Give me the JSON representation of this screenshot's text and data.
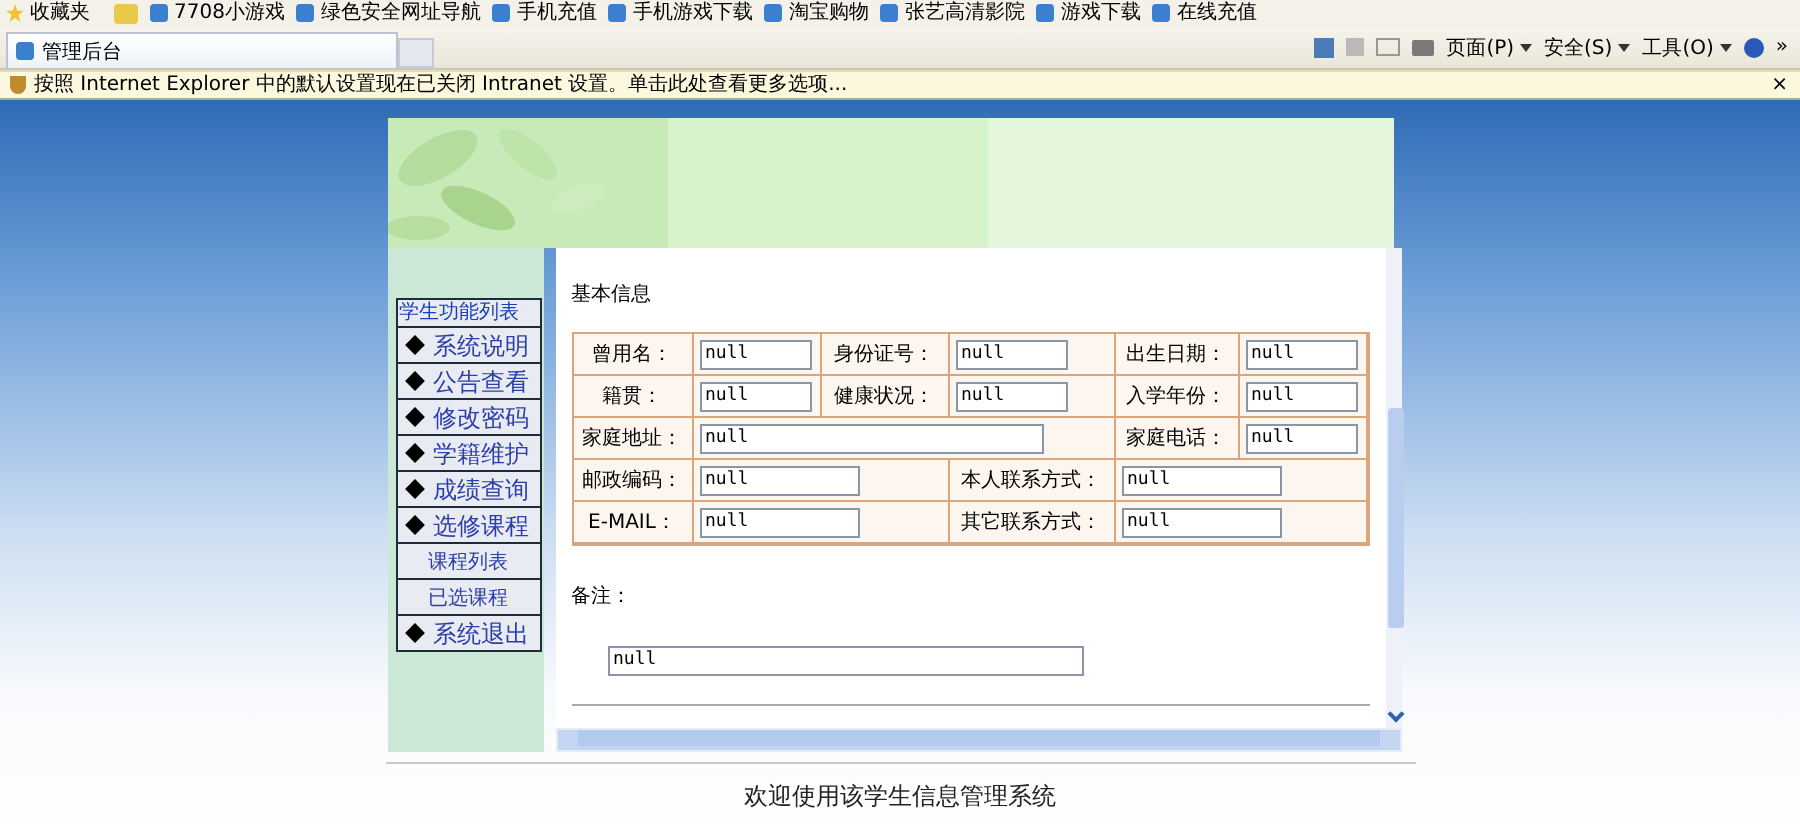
{
  "favorites_bar": {
    "title": "收藏夹",
    "links": [
      "7708小游戏",
      "绿色安全网址导航",
      "手机充值",
      "手机游戏下载",
      "淘宝购物",
      "张艺高清影院",
      "游戏下载",
      "在线充值"
    ]
  },
  "tabs": [
    {
      "label": "管理后台",
      "selected": true
    }
  ],
  "toolbar": {
    "menus": [
      "页面(P)",
      "安全(S)",
      "工具(O)"
    ],
    "more": "»"
  },
  "info_bar": {
    "text": "按照 Internet Explorer 中的默认设置现在已关闭 Intranet 设置。单击此处查看更多选项...",
    "close": "×"
  },
  "sidebar": {
    "title": "学生功能列表",
    "items": [
      {
        "kind": "main",
        "label": "系统说明"
      },
      {
        "kind": "main",
        "label": "公告查看"
      },
      {
        "kind": "main",
        "label": "修改密码"
      },
      {
        "kind": "main",
        "label": "学籍维护"
      },
      {
        "kind": "main",
        "label": "成绩查询"
      },
      {
        "kind": "main",
        "label": "选修课程"
      },
      {
        "kind": "sub",
        "label": "课程列表"
      },
      {
        "kind": "sub",
        "label": "已选课程"
      },
      {
        "kind": "main",
        "label": "系统退出"
      }
    ]
  },
  "form": {
    "title": "基本信息",
    "rows": [
      {
        "cells": [
          {
            "kind": "label",
            "text": "曾用名："
          },
          {
            "kind": "field",
            "value": "null"
          },
          {
            "kind": "label",
            "text": "身份证号："
          },
          {
            "kind": "field",
            "value": "null"
          },
          {
            "kind": "label",
            "text": "出生日期："
          },
          {
            "kind": "field",
            "value": "null"
          }
        ]
      },
      {
        "cells": [
          {
            "kind": "label",
            "text": "籍贯："
          },
          {
            "kind": "field",
            "value": "null"
          },
          {
            "kind": "label",
            "text": "健康状况："
          },
          {
            "kind": "field",
            "value": "null"
          },
          {
            "kind": "label",
            "text": "入学年份："
          },
          {
            "kind": "field",
            "value": "null"
          }
        ]
      },
      {
        "cells": [
          {
            "kind": "label",
            "text": "家庭地址："
          },
          {
            "kind": "field",
            "value": "null"
          },
          "",
          "",
          {
            "kind": "label",
            "text": "家庭电话："
          },
          {
            "kind": "field",
            "value": "null"
          }
        ]
      },
      {
        "cells": [
          {
            "kind": "label",
            "text": "邮政编码："
          },
          {
            "kind": "field",
            "value": "null"
          },
          "",
          {
            "kind": "label",
            "text": "本人联系方式："
          },
          {
            "kind": "field",
            "value": "null"
          },
          ""
        ]
      },
      {
        "cells": [
          {
            "kind": "label",
            "text": "E-MAIL："
          },
          {
            "kind": "field",
            "value": "null"
          },
          "",
          {
            "kind": "label",
            "text": "其它联系方式："
          },
          {
            "kind": "field",
            "value": "null"
          },
          ""
        ]
      }
    ],
    "remarks_label": "备注：",
    "remarks_value": "null"
  },
  "footer": "欢迎使用该学生信息管理系统"
}
